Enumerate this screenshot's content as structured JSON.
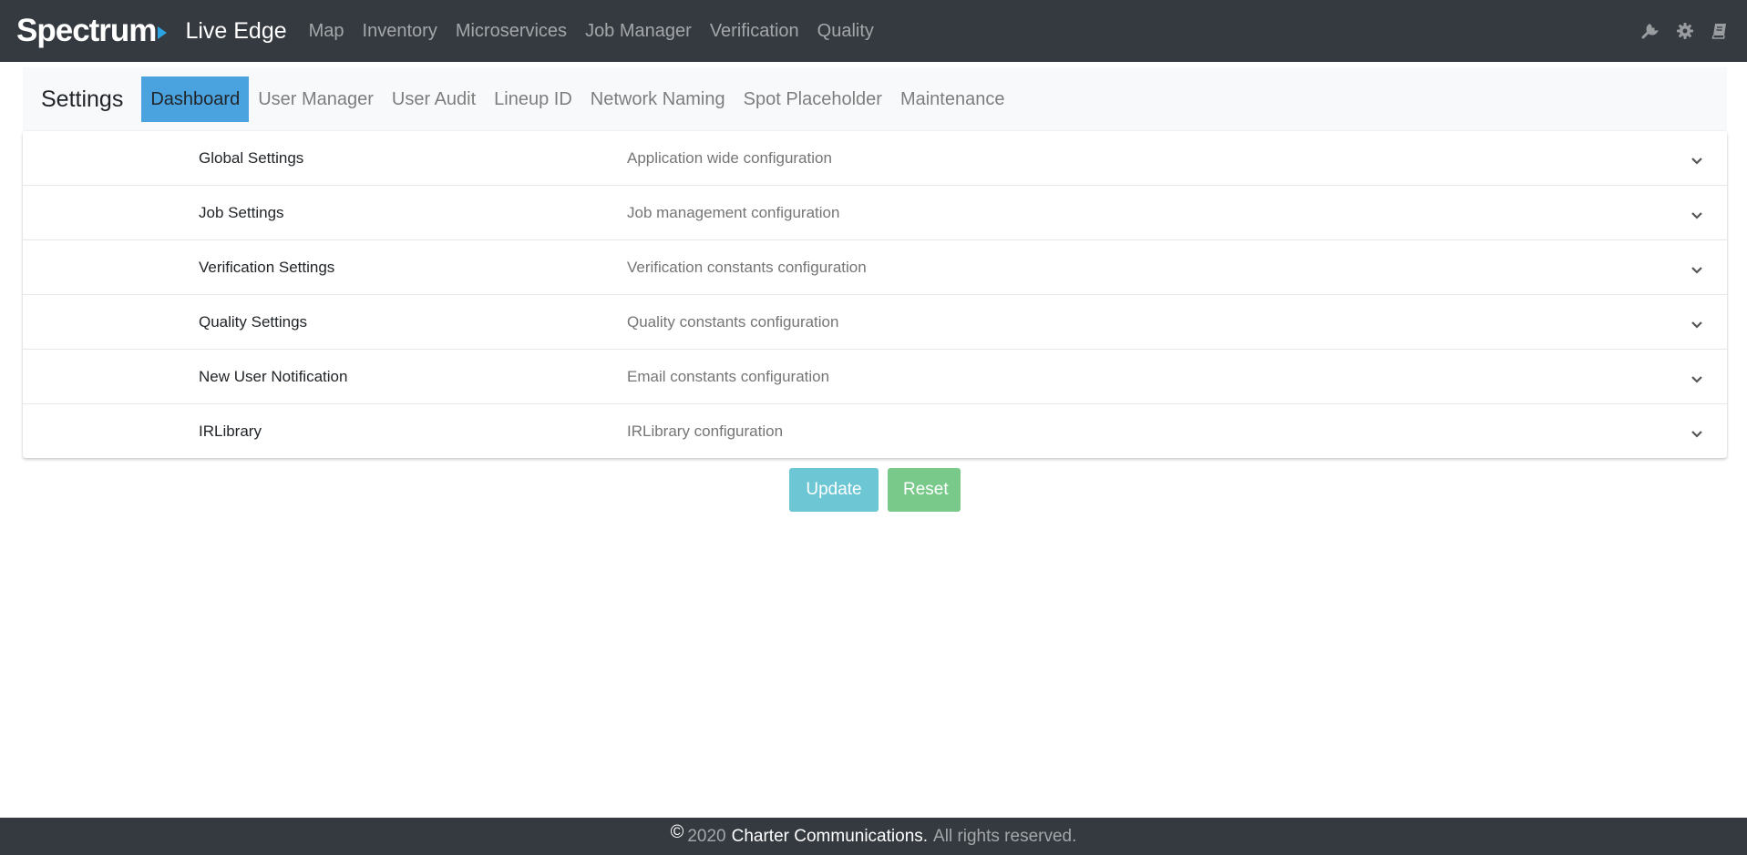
{
  "header": {
    "brand": "Spectrum",
    "app_name": "Live Edge",
    "nav": [
      "Map",
      "Inventory",
      "Microservices",
      "Job Manager",
      "Verification",
      "Quality"
    ],
    "icons": [
      "wrench-icon",
      "gear-icon",
      "book-icon"
    ]
  },
  "settings": {
    "title": "Settings",
    "tabs": [
      "Dashboard",
      "User Manager",
      "User Audit",
      "Lineup ID",
      "Network Naming",
      "Spot Placeholder",
      "Maintenance"
    ],
    "active_tab": "Dashboard"
  },
  "panels": [
    {
      "name": "Global Settings",
      "description": "Application wide configuration"
    },
    {
      "name": "Job Settings",
      "description": "Job management configuration"
    },
    {
      "name": "Verification Settings",
      "description": "Verification constants configuration"
    },
    {
      "name": "Quality Settings",
      "description": "Quality constants configuration"
    },
    {
      "name": "New User Notification",
      "description": "Email constants configuration"
    },
    {
      "name": "IRLibrary",
      "description": "IRLibrary configuration"
    }
  ],
  "actions": {
    "update_label": "Update",
    "reset_label": "Reset"
  },
  "footer": {
    "copyright_symbol": "©",
    "year": "2020",
    "company": "Charter Communications.",
    "rights": "All rights reserved."
  },
  "colors": {
    "navbar": "#343a40",
    "active_tab": "#4aa3df",
    "update_button": "#6cc6d4",
    "reset_button": "#79c98b",
    "brand_accent": "#2aa3e0"
  }
}
